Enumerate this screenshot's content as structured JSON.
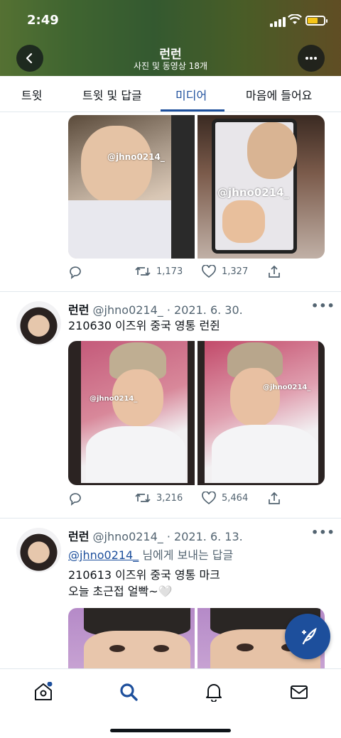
{
  "status_bar": {
    "time": "2:49"
  },
  "header": {
    "title": "런런",
    "subtitle": "사진 및 동영상 18개"
  },
  "tabs": [
    {
      "label": "트윗",
      "active": false
    },
    {
      "label": "트윗 및 답글",
      "active": false
    },
    {
      "label": "미디어",
      "active": true
    },
    {
      "label": "마음에 들어요",
      "active": false
    }
  ],
  "tweets": [
    {
      "watermarks": [
        "@jhno0214_",
        "@jhno0214_"
      ],
      "retweets": "1,173",
      "likes": "1,327"
    },
    {
      "display_name": "런런",
      "handle": "@jhno0214_",
      "date": "· 2021. 6. 30.",
      "text_lines": [
        "210630 이즈위 중국 영통 런쥔"
      ],
      "watermarks": [
        "@jhno0214_",
        "@jhno0214_"
      ],
      "retweets": "3,216",
      "likes": "5,464"
    },
    {
      "display_name": "런런",
      "handle": "@jhno0214_",
      "date": "· 2021. 6. 13.",
      "reply_to": "@jhno0214_",
      "reply_suffix": " 님에게 보내는 답글",
      "text_lines": [
        "210613 이즈위 중국 영통 마크",
        "오늘 초근접 얼빡~🤍"
      ]
    }
  ],
  "colors": {
    "accent": "#1d4f9c",
    "muted": "#536471",
    "text": "#0f1419",
    "divider": "#e1e8ed"
  },
  "icons": [
    "back-arrow-icon",
    "more-icon",
    "reply-icon",
    "retweet-icon",
    "like-icon",
    "share-icon",
    "compose-tweet-icon",
    "home-icon",
    "search-icon",
    "notifications-icon",
    "messages-icon"
  ]
}
